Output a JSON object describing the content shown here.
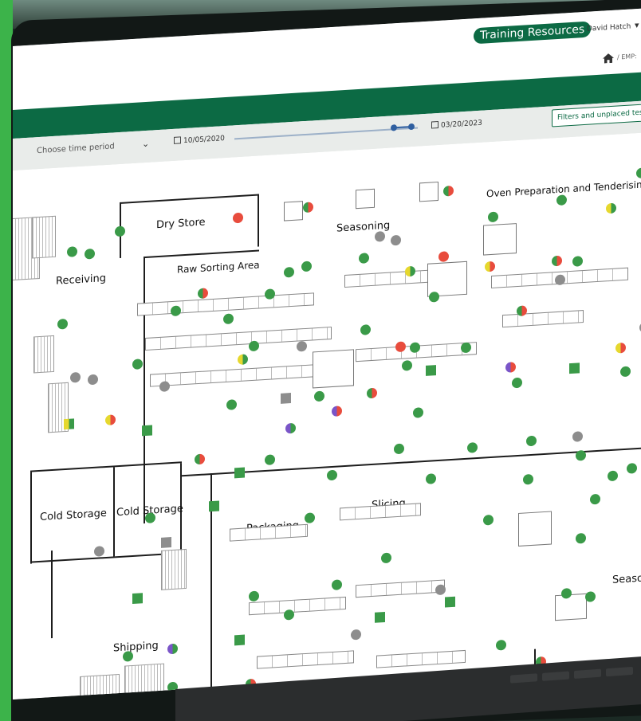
{
  "header": {
    "training_button": "Training Resources",
    "user_name": "David Hatch",
    "user_chevron": "▾",
    "breadcrumb_text": "/ EMP:"
  },
  "filters": {
    "time_period_placeholder": "Choose time period",
    "start_date": "10/05/2020",
    "end_date": "03/20/2023",
    "filters_button": "Filters and unplaced test p"
  },
  "floor_plan": {
    "rooms": [
      {
        "label": "Dry Store"
      },
      {
        "label": "Seasoning"
      },
      {
        "label": "Oven Preparation and Tenderising"
      },
      {
        "label": "Receiving"
      },
      {
        "label": "Raw Sorting Area"
      },
      {
        "label": "Cold Storage"
      },
      {
        "label": "Cold Storage"
      },
      {
        "label": "Packaging"
      },
      {
        "label": "Slicing"
      },
      {
        "label": "Shipping"
      },
      {
        "label": "Seaso"
      }
    ]
  },
  "colors": {
    "brand_green": "#0c6a44",
    "marker_green": "#3a9a48",
    "marker_red": "#e84c3d",
    "marker_gray": "#8d8d8d",
    "marker_yellow": "#e6d82e",
    "marker_purple": "#7a55c8",
    "side_green": "#3cb34a"
  },
  "icons": {
    "home": "home-icon",
    "calendar": "calendar-icon",
    "dropdown": "chevron-down-icon"
  }
}
